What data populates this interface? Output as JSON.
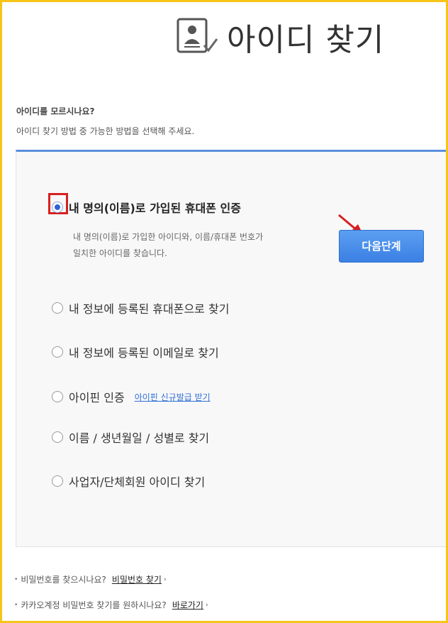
{
  "header": {
    "title": "아이디 찾기",
    "icon": "id-card-check-icon"
  },
  "intro": {
    "question": "아이디를 모르시나요?",
    "description": "아이디 찾기 방법 중 가능한 방법을 선택해 주세요."
  },
  "options": [
    {
      "label": "내 명의(이름)로 가입된 휴대폰 인증",
      "selected": true
    },
    {
      "label": "내 정보에 등록된 휴대폰으로 찾기",
      "selected": false
    },
    {
      "label": "내 정보에 등록된 이메일로 찾기",
      "selected": false
    },
    {
      "label": "아이핀 인증",
      "selected": false,
      "link": "아이핀 신규발급 받기"
    },
    {
      "label": "이름 / 생년월일 / 성별로 찾기",
      "selected": false
    },
    {
      "label": "사업자/단체회원 아이디 찾기",
      "selected": false
    }
  ],
  "selected_detail": {
    "line1": "내 명의(이름)로 가입한 아이디와, 이름/휴대폰 번호가",
    "line2": "일치한 아이디를 찾습니다.",
    "next_button": "다음단계"
  },
  "footer": [
    {
      "text": "비밀번호를 찾으시나요?",
      "link": "비밀번호 찾기"
    },
    {
      "text": "카카오계정 비밀번호 찾기를 원하시나요?",
      "link": "바로가기"
    }
  ],
  "colors": {
    "accent": "#5a8fdc",
    "button": "#3b80e3",
    "highlight": "#d81f1f",
    "frame": "#f5c518"
  }
}
